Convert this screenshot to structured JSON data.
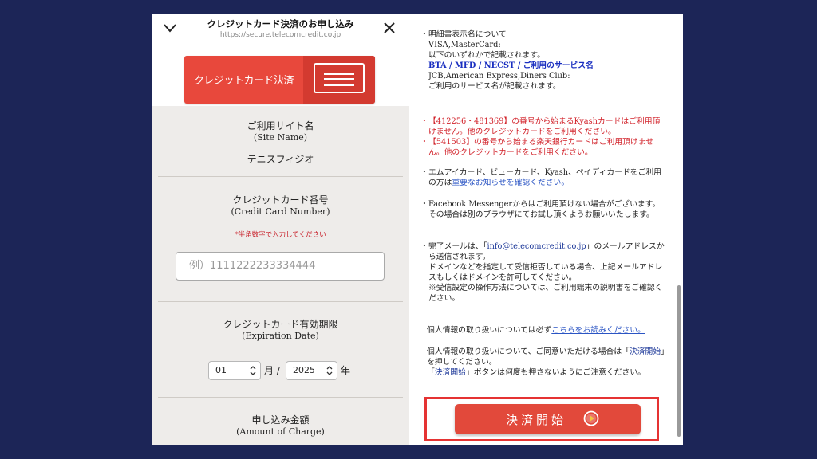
{
  "browser": {
    "title": "クレジットカード決済のお申し込み",
    "url": "https://secure.telecomcredit.co.jp",
    "chevron_icon": "chevron-down-icon",
    "close_icon": "close-icon"
  },
  "payment_method": {
    "label": "クレジットカード決済",
    "icon": "credit-card-icon"
  },
  "site": {
    "label": "ご利用サイト名",
    "label_en": "(Site Name)",
    "value": "テニスフィジオ"
  },
  "card_number": {
    "label": "クレジットカード番号",
    "label_en": "(Credit Card Number)",
    "note": "*半角数字で入力してください",
    "placeholder": "例）1111222233334444"
  },
  "expiration": {
    "label": "クレジットカード有効期限",
    "label_en": "(Expiration Date)",
    "month_value": "01",
    "month_unit": "月 /",
    "year_value": "2025",
    "year_unit": "年"
  },
  "amount": {
    "label": "申し込み金額",
    "label_en": "(Amount of Charge)"
  },
  "notices": {
    "statement": {
      "title": "明細書表示名について",
      "line1": "VISA,MasterCard:",
      "line2": "以下のいずれかで記載されます。",
      "line3": "BTA / MFD / NECST / ご利用のサービス名",
      "line4": "JCB,American Express,Diners Club:",
      "line5": "ご利用のサービス名が記載されます。"
    },
    "kyash": "【412256・481369】の番号から始まるKyashカードはご利用頂けません。他のクレジットカードをご利用ください。",
    "rakuten": "【541503】の番号から始まる楽天銀行カードはご利用頂けません。他のクレジットカードをご利用ください。",
    "prepaid_text": "エムアイカード、ビューカード、Kyash、ペイディカードをご利用の方は",
    "prepaid_link": "重要なお知らせを確認ください。",
    "messenger": "Facebook Messengerからはご利用頂けない場合がございます。その場合は別のブラウザにてお試し頂くようお願いいたします。",
    "mail_text1": "完了メールは、「",
    "mail_address": "info@telecomcredit.co.jp",
    "mail_text2": "」のメールアドレスから送信されます。",
    "mail_text3": "ドメインなどを指定して受信拒否している場合、上記メールアドレスもしくはドメインを許可してください。",
    "mail_text4": "※受信設定の操作方法については、ご利用端末の説明書をご確認ください。",
    "privacy_text": "個人情報の取り扱いについては必ず",
    "privacy_link": "こちらをお読みください。",
    "agree_text1": "個人情報の取り扱いについて、ご同意いただける場合は「",
    "agree_link": "決済開始",
    "agree_text2": "」を押してください。",
    "once_text1": "「",
    "once_link": "決済開始",
    "once_text2": "」ボタンは何度も押さないようにご注意ください。"
  },
  "submit": {
    "label": "決済開始",
    "icon": "play-circle-icon"
  }
}
